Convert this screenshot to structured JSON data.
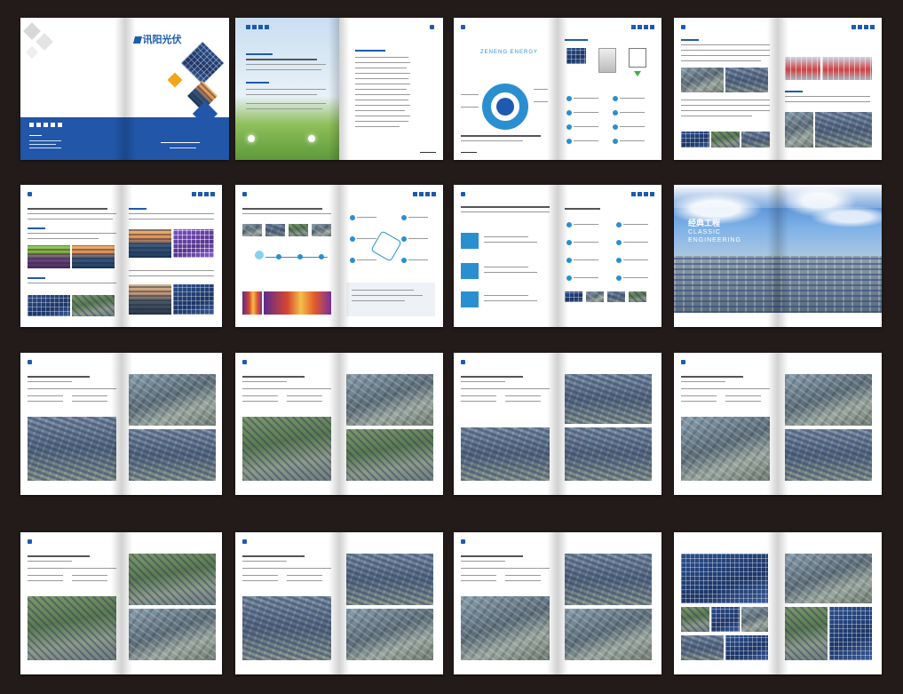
{
  "cover": {
    "brand": "讯阳光伏",
    "icons": [
      "grid-icon",
      "panel-icon",
      "house-icon",
      "chart-icon",
      "leaf-icon"
    ]
  },
  "eco_page": {
    "heading": "ZENENG ENERGY"
  },
  "classic_page": {
    "title_cn": "经典工程",
    "title_en_1": "CLASSIC",
    "title_en_2": "ENGINEERING"
  },
  "colors": {
    "brand_blue": "#1e5bb0",
    "accent_blue": "#2a8fd0",
    "background": "#231b1a",
    "accent_orange": "#f2a61b"
  }
}
